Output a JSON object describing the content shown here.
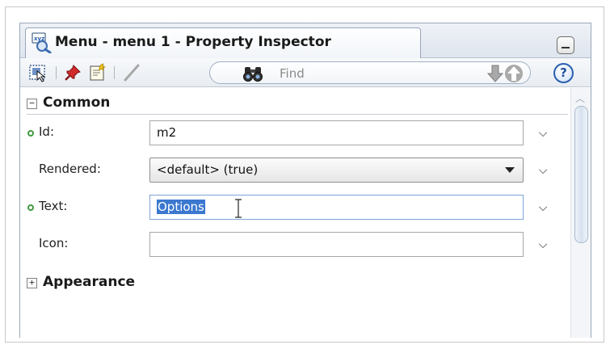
{
  "panel": {
    "title": "Menu - menu 1 - Property Inspector"
  },
  "toolbar": {
    "find_placeholder": "Find",
    "help_label": "?"
  },
  "sections": {
    "common": {
      "expander": "−",
      "title": "Common"
    },
    "appearance": {
      "expander": "+",
      "title": "Appearance"
    }
  },
  "properties": {
    "id": {
      "label": "Id:",
      "value": "m2",
      "required": true
    },
    "rendered": {
      "label": "Rendered:",
      "value": "<default> (true)"
    },
    "text": {
      "label": "Text:",
      "value": "Options",
      "required": true
    },
    "icon": {
      "label": "Icon:",
      "value": ""
    }
  },
  "chevron": "⌵",
  "colors": {
    "required_dot": "#3f9a3f",
    "selection": "#3b78d0",
    "accent_blue": "#2a5fb0"
  },
  "icons": {
    "title": "property-inspector-icon",
    "toolbar": [
      "select-component-icon",
      "pin-icon",
      "edit-icon",
      "pencil-icon",
      "binoculars-icon",
      "arrow-down-icon",
      "arrow-up-icon",
      "help-icon"
    ]
  }
}
